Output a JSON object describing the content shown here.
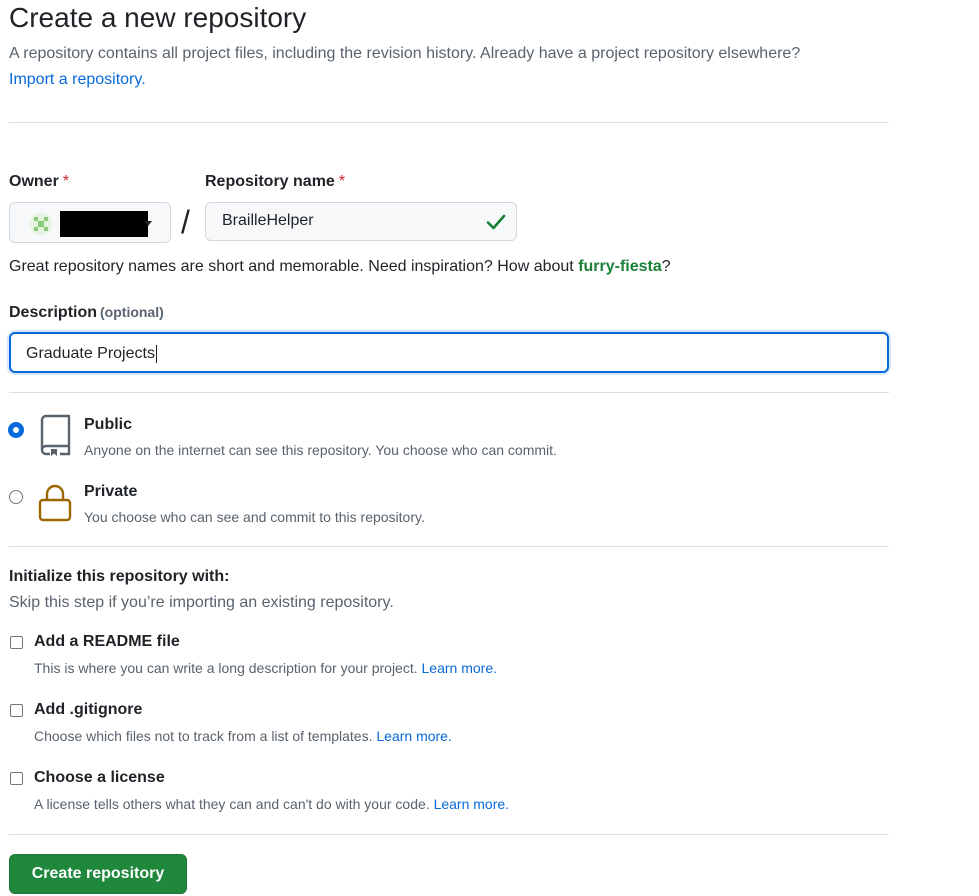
{
  "header": {
    "title": "Create a new repository",
    "subtitle": "A repository contains all project files, including the revision history. Already have a project repository elsewhere?",
    "import_link": "Import a repository."
  },
  "owner": {
    "label": "Owner",
    "required_mark": "*"
  },
  "repo_name": {
    "label": "Repository name",
    "required_mark": "*",
    "value": "BrailleHelper",
    "separator": "/",
    "valid_icon": "check-icon"
  },
  "name_hint": {
    "text": "Great repository names are short and memorable. Need inspiration? How about ",
    "suggestion": "furry-fiesta",
    "suffix": "?"
  },
  "description": {
    "label": "Description",
    "optional": "(optional)",
    "value": "Graduate Projects"
  },
  "visibility": {
    "options": [
      {
        "title": "Public",
        "note": "Anyone on the internet can see this repository. You choose who can commit.",
        "icon": "repo-icon",
        "selected": true
      },
      {
        "title": "Private",
        "note": "You choose who can see and commit to this repository.",
        "icon": "lock-icon",
        "selected": false
      }
    ]
  },
  "initialize": {
    "title": "Initialize this repository with:",
    "subtitle": "Skip this step if you’re importing an existing repository.",
    "items": [
      {
        "title": "Add a README file",
        "note": "This is where you can write a long description for your project.",
        "link": "Learn more.",
        "checked": false
      },
      {
        "title": "Add .gitignore",
        "note": "Choose which files not to track from a list of templates.",
        "link": "Learn more.",
        "checked": false
      },
      {
        "title": "Choose a license",
        "note": "A license tells others what they can and can't do with your code.",
        "link": "Learn more.",
        "checked": false
      }
    ]
  },
  "submit": {
    "label": "Create repository"
  },
  "colors": {
    "accent": "#0969da",
    "success": "#1a7f37",
    "button": "#1f883d",
    "danger": "#d1242f",
    "lock": "#9a6700"
  }
}
